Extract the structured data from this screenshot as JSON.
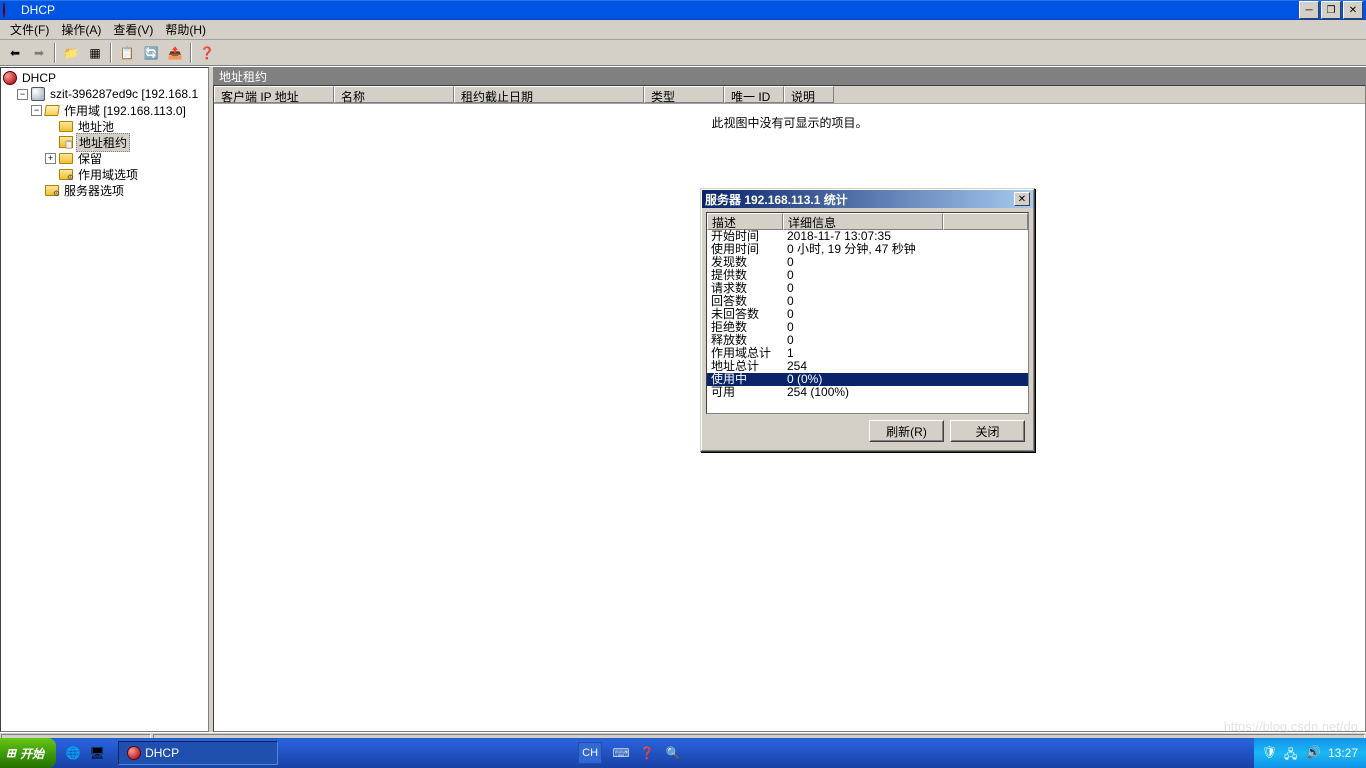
{
  "window": {
    "title": "DHCP"
  },
  "menu": {
    "file": "文件(F)",
    "action": "操作(A)",
    "view": "查看(V)",
    "help": "帮助(H)"
  },
  "tree": {
    "root": "DHCP",
    "server": "szit-396287ed9c [192.168.1",
    "scope": "作用域 [192.168.113.0]",
    "pool": "地址池",
    "lease": "地址租约",
    "reserve": "保留",
    "scopeopts": "作用域选项",
    "serveropts": "服务器选项"
  },
  "right": {
    "header": "地址租约",
    "cols": {
      "client": "客户端 IP 地址",
      "name": "名称",
      "expire": "租约截止日期",
      "type": "类型",
      "uid": "唯一 ID",
      "desc": "说明"
    },
    "empty": "此视图中没有可显示的项目。"
  },
  "dialog": {
    "title": "服务器 192.168.113.1 统计",
    "col1": "描述",
    "col2": "详细信息",
    "rows": [
      {
        "k": "开始时间",
        "v": "2018-11-7 13:07:35"
      },
      {
        "k": "使用时间",
        "v": "0 小时, 19 分钟, 47 秒钟"
      },
      {
        "k": "发现数",
        "v": "0"
      },
      {
        "k": "提供数",
        "v": "0"
      },
      {
        "k": "请求数",
        "v": "0"
      },
      {
        "k": "回答数",
        "v": "0"
      },
      {
        "k": "未回答数",
        "v": "0"
      },
      {
        "k": "拒绝数",
        "v": "0"
      },
      {
        "k": "释放数",
        "v": "0"
      },
      {
        "k": "作用域总计",
        "v": "1"
      },
      {
        "k": "地址总计",
        "v": "254"
      },
      {
        "k": "使用中",
        "v": "0 (0%)",
        "sel": true
      },
      {
        "k": "可用",
        "v": "254 (100%)"
      }
    ],
    "refresh": "刷新(R)",
    "close": "关闭"
  },
  "taskbar": {
    "start": "开始",
    "task": "DHCP",
    "lang": "CH",
    "time": "13:27"
  },
  "watermark": "https://blog.csdn.net/dg"
}
